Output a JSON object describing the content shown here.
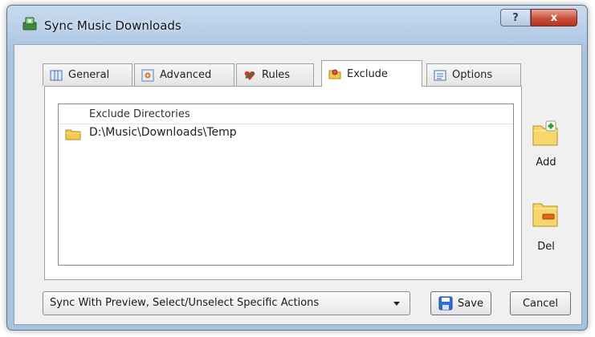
{
  "window": {
    "title": "Sync Music Downloads",
    "help_label": "?",
    "close_label": "x"
  },
  "tabs": [
    {
      "label": "General",
      "icon": "general-icon"
    },
    {
      "label": "Advanced",
      "icon": "advanced-icon"
    },
    {
      "label": "Rules",
      "icon": "rules-icon"
    },
    {
      "label": "Exclude",
      "icon": "exclude-icon",
      "active": true
    },
    {
      "label": "Options",
      "icon": "options-icon"
    }
  ],
  "exclude_list": {
    "header": "Exclude Directories",
    "items": [
      {
        "path": "D:\\Music\\Downloads\\Temp",
        "icon": "folder-icon"
      }
    ]
  },
  "side_buttons": {
    "add_label": "Add",
    "del_label": "Del"
  },
  "footer": {
    "sync_mode": "Sync With Preview, Select/Unselect Specific Actions",
    "save_label": "Save",
    "cancel_label": "Cancel"
  },
  "colors": {
    "titlebar": "#b9cfe7",
    "close_button": "#c9503c",
    "folder": "#f2c94c",
    "add_accent": "#2f9a2f",
    "del_accent": "#e06a1a"
  }
}
